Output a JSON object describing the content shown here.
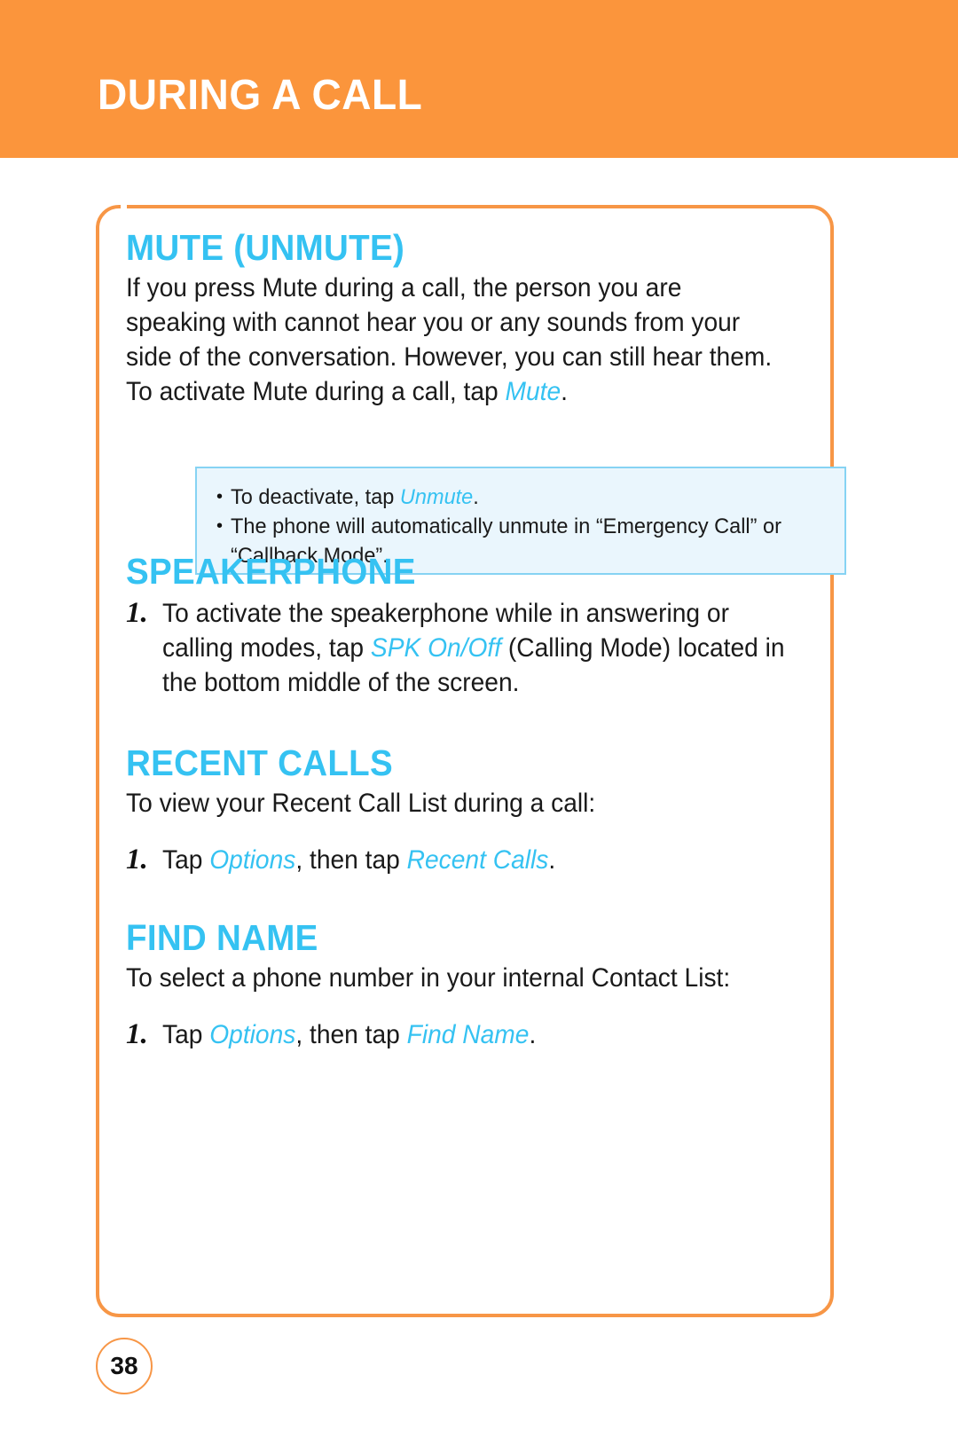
{
  "page": {
    "chapter_title": "DURING A CALL",
    "page_number": "38"
  },
  "colors": {
    "header_band": "#FB953C",
    "card_border": "#F79646",
    "heading_cyan": "#35C2F2",
    "note_background": "#EAF6FD",
    "note_border": "#86D3F3",
    "body_text": "#1A1A1A"
  },
  "sections": {
    "mute": {
      "heading": "MUTE (UNMUTE)",
      "paragraph_part1": "If you press Mute during a call, the person you are speaking with cannot hear you or any sounds from your side of the conversation. However, you can still hear them. To activate Mute during a call, tap ",
      "paragraph_highlight": "Mute",
      "paragraph_part2": ".",
      "note": {
        "items": [
          {
            "bullet": "•",
            "text_part1": "To deactivate, tap ",
            "highlight": "Unmute",
            "text_part2": "."
          },
          {
            "bullet": "•",
            "text_part1": "The phone will automatically unmute in “Emergency Call” or “Callback Mode”.",
            "highlight": "",
            "text_part2": ""
          }
        ]
      }
    },
    "speakerphone": {
      "heading": "SPEAKERPHONE",
      "step_number": "1.",
      "step_part1": "To activate the speakerphone while in answering or calling modes, tap ",
      "step_highlight": "SPK On/Off",
      "step_part2": " (Calling Mode) located in the bottom middle of the screen."
    },
    "recent_calls": {
      "heading": "RECENT CALLS",
      "intro": "To view your Recent Call List during a call:",
      "step_number": "1.",
      "step_part1": "Tap ",
      "step_highlight1": "Options",
      "step_part2": ", then tap ",
      "step_highlight2": "Recent Calls",
      "step_part3": "."
    },
    "find_name": {
      "heading": "FIND NAME",
      "intro": "To select a phone number in your internal Contact List:",
      "step_number": "1.",
      "step_part1": "Tap ",
      "step_highlight1": "Options",
      "step_part2": ", then tap ",
      "step_highlight2": "Find Name",
      "step_part3": "."
    }
  }
}
